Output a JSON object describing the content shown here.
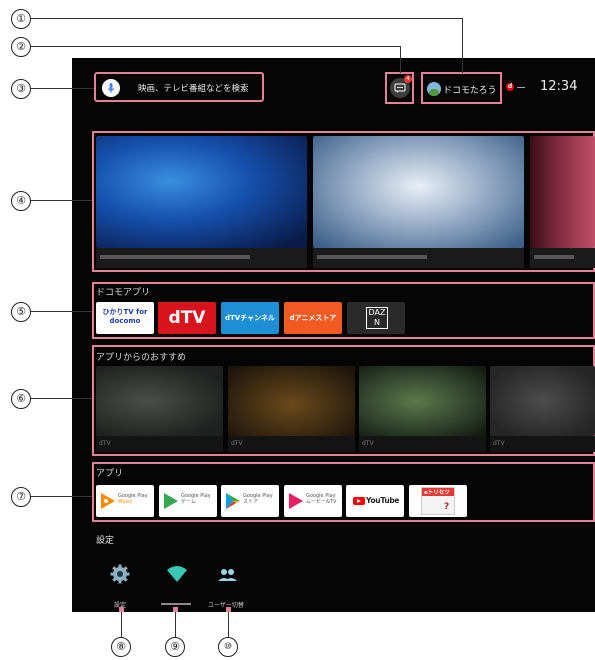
{
  "callouts": [
    "①",
    "②",
    "③",
    "④",
    "⑤",
    "⑥",
    "⑦",
    "⑧",
    "⑨",
    "⑩"
  ],
  "header": {
    "search_placeholder": "映画、テレビ番組などを検索",
    "notification_count": "4",
    "user_name": "ドコモたろう",
    "time": "12:34"
  },
  "docomo_apps": {
    "title": "ドコモアプリ",
    "items": [
      "ひかりTV for docomo",
      "dTV",
      "dTVチャンネル",
      "dアニメストア",
      "DAZN"
    ]
  },
  "recommend": {
    "title": "アプリからのおすすめ",
    "cards": [
      "dTV",
      "dTV",
      "dTV",
      "dTV"
    ]
  },
  "apps": {
    "title": "アプリ",
    "items": [
      {
        "name": "Google Play",
        "sub": "Music"
      },
      {
        "name": "Google Play",
        "sub": "ゲーム"
      },
      {
        "name": "Google Play",
        "sub": "ストア"
      },
      {
        "name": "Google Play",
        "sub": "ムービー&TV"
      },
      {
        "name": "YouTube",
        "sub": ""
      },
      {
        "name": "eトリセツ",
        "sub": ""
      }
    ]
  },
  "settings": {
    "title": "設定",
    "items": [
      {
        "label": "設定",
        "icon": "gear-icon"
      },
      {
        "label": "",
        "icon": "wifi-icon"
      },
      {
        "label": "ユーザー切替",
        "icon": "users-icon"
      }
    ]
  },
  "colors": {
    "highlight": "#e0839a",
    "dtv_red": "#d7141d",
    "dtv_channel_blue": "#1e8fd5",
    "danime_orange": "#f15a22",
    "dazn_dark": "#2a2a2a"
  }
}
